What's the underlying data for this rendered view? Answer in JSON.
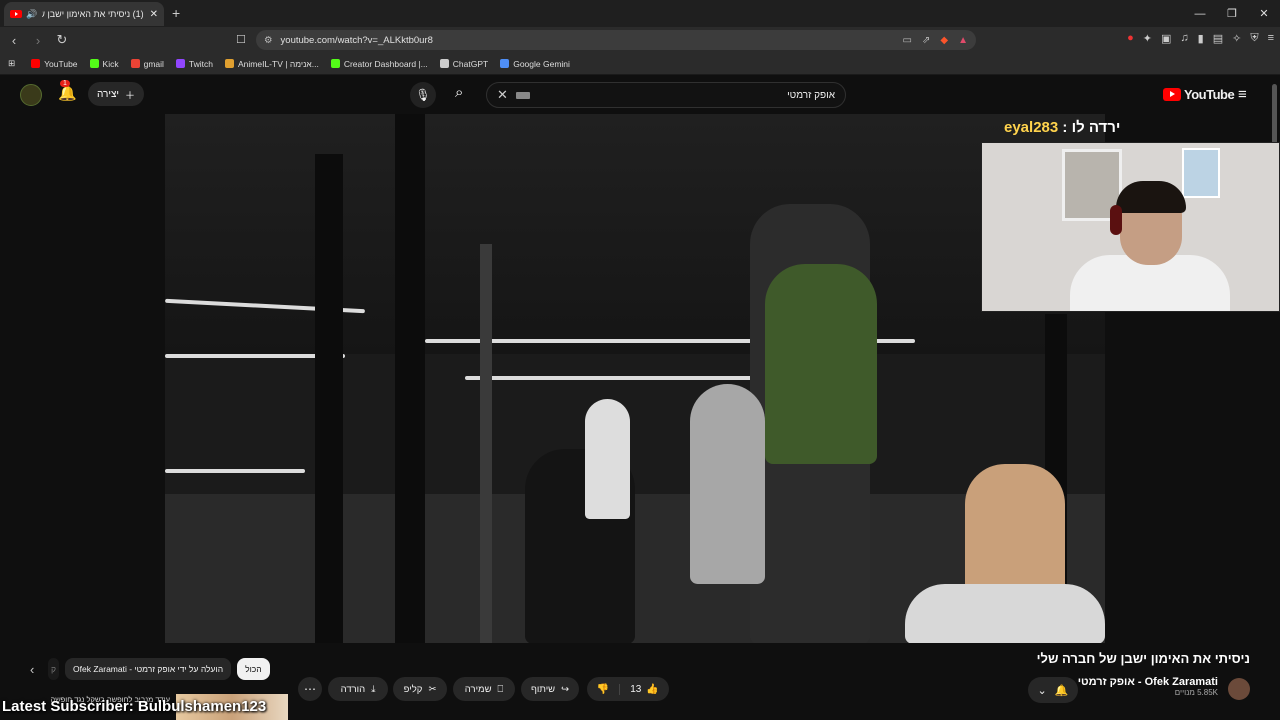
{
  "browser": {
    "tab_title": "(1) ניסיתי את האימון ישבן של חברה שלי",
    "url": "youtube.com/watch?v=_ALKktb0ur8",
    "bookmarks": [
      {
        "label": "YouTube",
        "color": "#ff0000"
      },
      {
        "label": "Kick",
        "color": "#53fc18"
      },
      {
        "label": "gmail",
        "color": "#ea4335"
      },
      {
        "label": "Twitch",
        "color": "#9146ff"
      },
      {
        "label": "AnimeIL-TV | אנימה...",
        "color": "#e0a030"
      },
      {
        "label": "Creator Dashboard |...",
        "color": "#53fc18"
      },
      {
        "label": "ChatGPT",
        "color": "#cccccc"
      },
      {
        "label": "Google Gemini",
        "color": "#4f8ff7"
      }
    ]
  },
  "youtube": {
    "notification_count": "1",
    "create_label": "יצירה",
    "search_query": "אופק זרמטי",
    "logo_text": "YouTube"
  },
  "stream_overlay": {
    "name": "eyal283",
    "caption": "ירדה לו :",
    "latest_subscriber": "Latest Subscriber: Bulbulshamen123"
  },
  "video": {
    "title": "ניסיתי את האימון ישבן של חברה שלי",
    "channel_name": "Ofek Zaramati - אופק זרמטי",
    "subscribers": "5.85K מנויים",
    "likes": "13",
    "share_label": "שיתוף",
    "save_label": "שמירה",
    "clip_label": "קליפ",
    "download_label": "הורדה"
  },
  "recommendations": {
    "chips": [
      "הכול",
      "הועלה על ידי אופק זרמטי - Ofek Zaramati",
      "ק"
    ],
    "next_title": "עודד מנביב לחופשה בשקל נגד חופשה"
  }
}
